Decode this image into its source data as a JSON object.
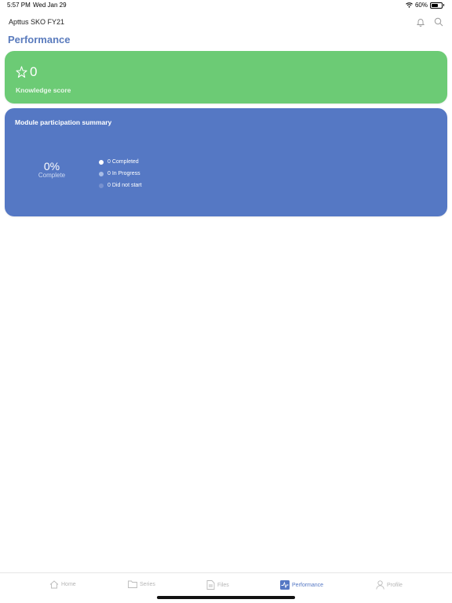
{
  "status_bar": {
    "time": "5:57 PM",
    "date": "Wed Jan 29",
    "battery": "60%"
  },
  "header": {
    "app_title": "Apttus SKO FY21"
  },
  "page": {
    "title": "Performance"
  },
  "knowledge": {
    "score": "0",
    "label": "Knowledge score"
  },
  "module_summary": {
    "title": "Module participation summary",
    "percent": "0%",
    "percent_label": "Complete",
    "legend": [
      {
        "label": "0 Completed",
        "color": "#ffffff"
      },
      {
        "label": "0 In Progress",
        "color": "#a8bde6"
      },
      {
        "label": "0 Did not start",
        "color": "#7892d0"
      }
    ]
  },
  "tabs": [
    {
      "label": "Home",
      "icon": "home-icon"
    },
    {
      "label": "Series",
      "icon": "folder-icon"
    },
    {
      "label": "Files",
      "icon": "file-icon"
    },
    {
      "label": "Performance",
      "icon": "performance-icon",
      "active": true
    },
    {
      "label": "Profile",
      "icon": "person-icon"
    }
  ],
  "colors": {
    "accent": "#5578c4",
    "score_card": "#6ccb75",
    "module_card": "#5578c4",
    "title": "#5a7bbd"
  }
}
